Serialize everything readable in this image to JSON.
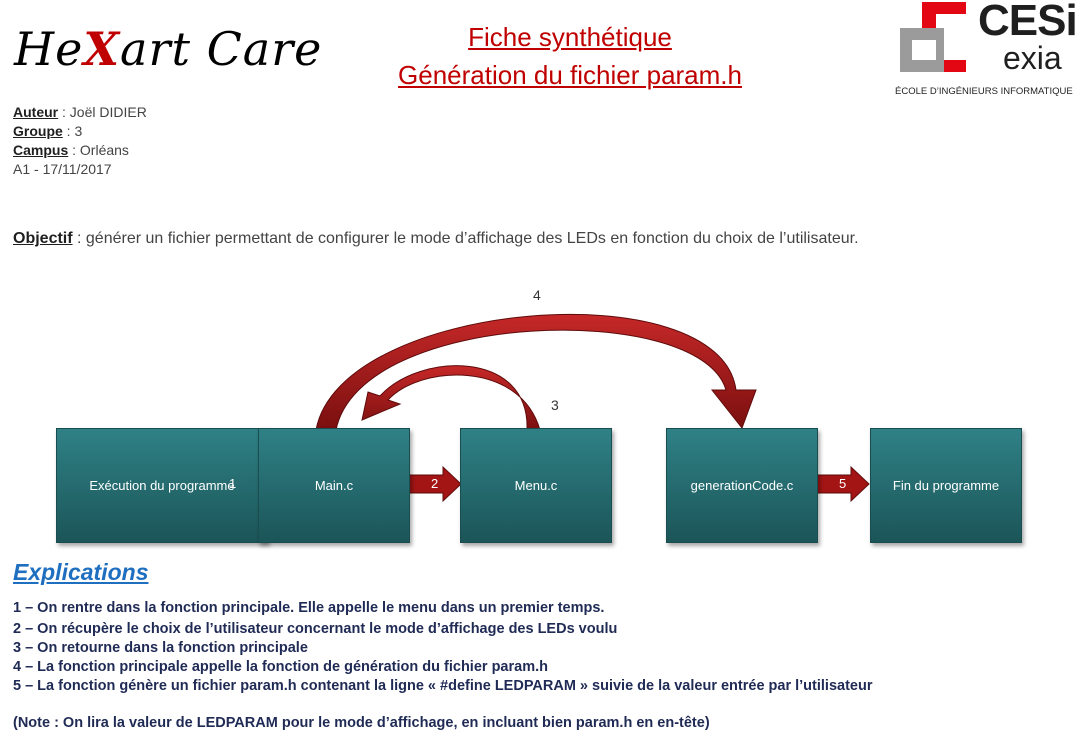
{
  "logo_left": {
    "part1": "He",
    "x": "X",
    "part2": "art Care"
  },
  "title": {
    "line1": "Fiche synthétique",
    "line2": "Génération du fichier param.h"
  },
  "logo_right": {
    "name": "CESi",
    "sub": "exia",
    "school": "ÉCOLE D’INGÉNIEURS INFORMATIQUE"
  },
  "meta": {
    "author_label": "Auteur",
    "author": " : Joël DIDIER",
    "group_label": "Groupe",
    "group": " : 3",
    "campus_label": "Campus",
    "campus": " : Orléans",
    "date": "A1 - 17/11/2017"
  },
  "objectif": {
    "label": "Objectif",
    "text": " : générer un fichier permettant de configurer le mode d’affichage des LEDs en fonction du choix de l’utilisateur."
  },
  "diagram": {
    "boxes": [
      "Exécution du programme",
      "Main.c",
      "Menu.c",
      "generationCode.c",
      "Fin du programme"
    ],
    "arrow_labels": [
      "1",
      "2",
      "3",
      "4",
      "5"
    ],
    "colors": {
      "box": "#236a6e",
      "arrow": "#a31515"
    }
  },
  "explications": {
    "title": "Explications",
    "items": [
      "1 – On rentre dans la fonction principale. Elle appelle le menu dans un premier temps.",
      "2 – On récupère le choix de l’utilisateur concernant le mode d’affichage des LEDs voulu",
      "3 – On retourne dans la fonction principale",
      "4 – La fonction principale appelle la fonction de génération du fichier param.h",
      "5 – La fonction génère un fichier param.h contenant la ligne « #define LEDPARAM » suivie de la valeur entrée par l’utilisateur"
    ],
    "note": "(Note : On lira la valeur de LEDPARAM pour le mode d’affichage, en incluant bien param.h en en-tête)"
  }
}
